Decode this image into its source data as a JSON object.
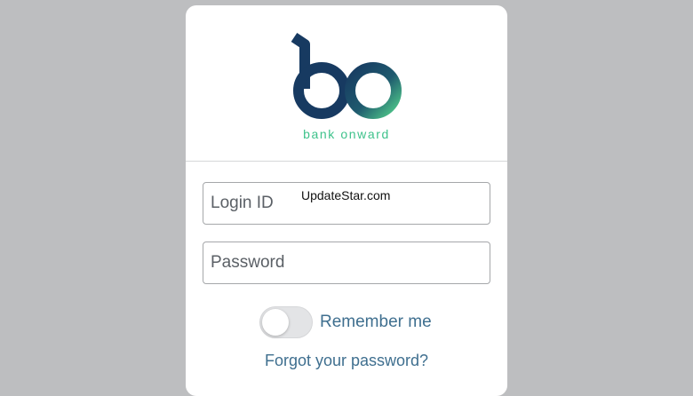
{
  "brand": {
    "logo_text": "bo",
    "tagline": "bank onward",
    "colors": {
      "navy": "#173a61",
      "teal": "#2e8a8a",
      "green": "#3ec28b"
    }
  },
  "login": {
    "login_id_placeholder": "Login ID",
    "password_placeholder": "Password",
    "remember_label": "Remember me",
    "remember_checked": false,
    "forgot_link": "Forgot your password?"
  },
  "overlay": {
    "watermark": "UpdateStar.com"
  }
}
